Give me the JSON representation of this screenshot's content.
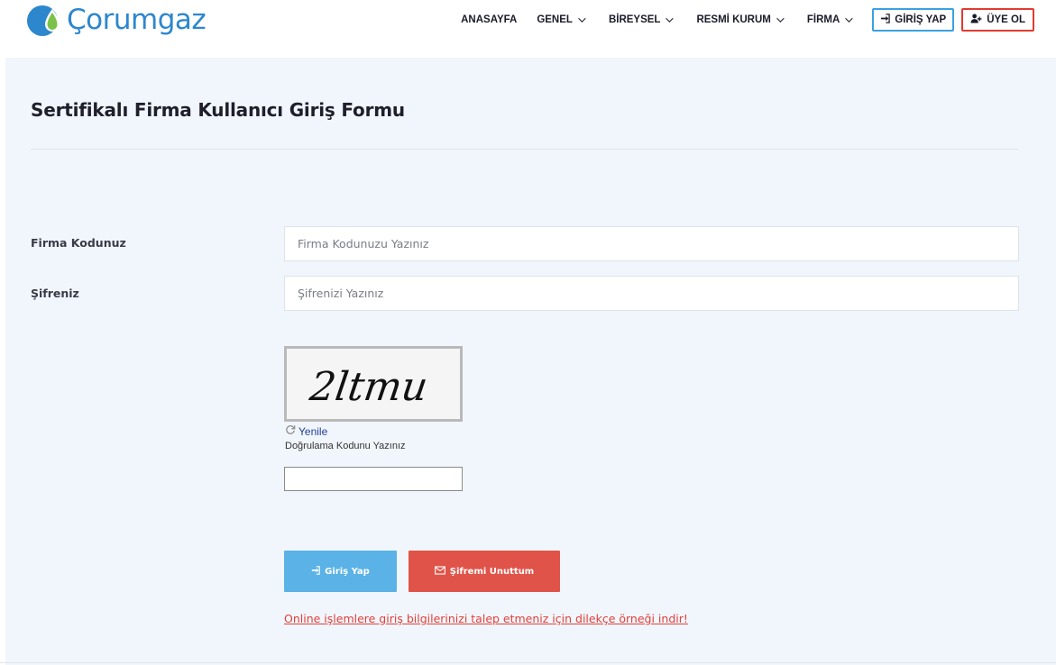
{
  "brand": {
    "name": "Çorumgaz",
    "color": "#2d87cd",
    "accent_drop": "#7cc14a"
  },
  "nav": {
    "items": [
      {
        "label": "ANASAYFA",
        "dropdown": false
      },
      {
        "label": "GENEL",
        "dropdown": true
      },
      {
        "label": "BİREYSEL",
        "dropdown": true
      },
      {
        "label": "RESMİ KURUM",
        "dropdown": true
      },
      {
        "label": "FİRMA",
        "dropdown": true
      }
    ],
    "login_label": "GİRİŞ YAP",
    "signup_label": "ÜYE OL",
    "login_icon": "sign-in-icon",
    "signup_icon": "user-plus-icon"
  },
  "form": {
    "title": "Sertifikalı Firma Kullanıcı Giriş Formu",
    "firm_code": {
      "label": "Firma Kodunuz",
      "placeholder": "Firma Kodunuzu Yazınız",
      "value": ""
    },
    "password": {
      "label": "Şifreniz",
      "placeholder": "Şifrenizi Yazınız",
      "value": ""
    },
    "captcha": {
      "text": "2ltmu",
      "refresh_label": "Yenile",
      "refresh_icon": "refresh-icon",
      "verify_label": "Doğrulama Kodunu Yazınız",
      "value": ""
    },
    "submit_label": "Giriş Yap",
    "submit_icon": "sign-in-icon",
    "forgot_label": "Şifremi Unuttum",
    "forgot_icon": "envelope-icon",
    "download_link": "Online işlemlere giriş bilgilerinizi talep etmeniz için dilekçe örneği indir!"
  },
  "colors": {
    "panel_bg": "#f1f6fc",
    "submit_bg": "#5ab2e6",
    "forgot_bg": "#e05348",
    "login_border": "#3aa1e0",
    "signup_border": "#e13b30",
    "link": "#e0403a"
  }
}
